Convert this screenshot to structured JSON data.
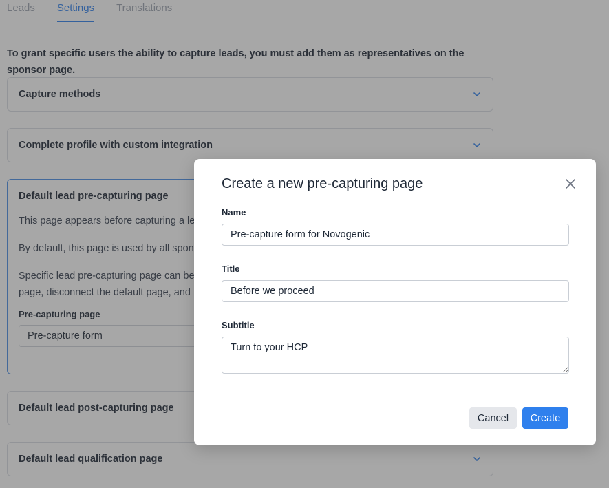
{
  "tabs": [
    {
      "label": "Leads",
      "active": false
    },
    {
      "label": "Settings",
      "active": true
    },
    {
      "label": "Translations",
      "active": false
    }
  ],
  "intro_text": "To grant specific users the ability to capture leads, you must add them as representatives on the sponsor page.",
  "sections": {
    "capture_methods": {
      "title": "Capture methods"
    },
    "complete_profile": {
      "title": "Complete profile with custom integration"
    },
    "default_pre": {
      "title": "Default lead pre-capturing page",
      "paragraph_1": "This page appears before capturing a le",
      "paragraph_2": "By default, this page is used by all spon",
      "paragraph_3_line_1": "Specific lead pre-capturing page can be",
      "paragraph_3_line_2": "page, disconnect the default page, and",
      "field_label": "Pre-capturing page",
      "field_value": "Pre-capture form"
    },
    "default_post": {
      "title": "Default lead post-capturing page"
    },
    "qualification": {
      "title": "Default lead qualification page"
    }
  },
  "modal": {
    "title": "Create a new pre-capturing page",
    "name_label": "Name",
    "name_value": "Pre-capture form for Novogenic",
    "title_label": "Title",
    "title_value": "Before we proceed",
    "subtitle_label": "Subtitle",
    "subtitle_value": "Turn to your HCP",
    "cancel_label": "Cancel",
    "create_label": "Create"
  },
  "colors": {
    "accent": "#2f80ed",
    "overlay": "rgba(60,60,60,0.45)",
    "border": "#d9dde3"
  },
  "icons": {
    "accordion_toggle": "chevron-down-icon",
    "modal_close": "close-icon"
  }
}
